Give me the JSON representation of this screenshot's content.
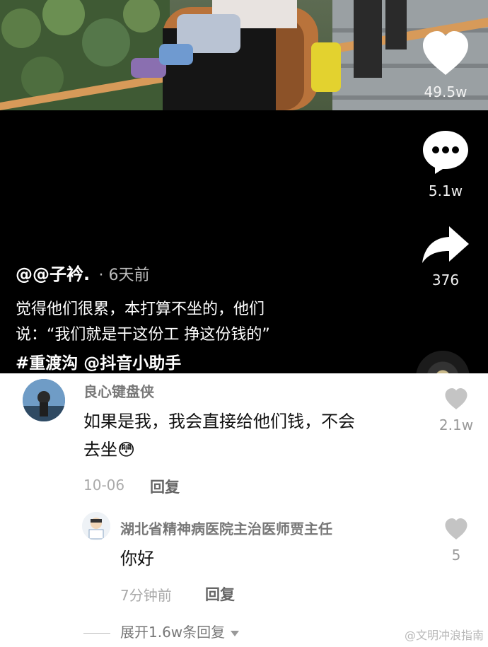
{
  "video": {
    "likes": "49.5w",
    "comments_count": "5.1w",
    "shares": "376",
    "author": "@@子衿.",
    "posted": "· 6天前",
    "caption_line1": "觉得他们很累，本打算不坐的，他们",
    "caption_line2": "说：“我们就是干这份工 挣这份钱的”",
    "tag_topic": "#重渡沟",
    "tag_mention": "@抖音小助手"
  },
  "comments": [
    {
      "nickname": "良心键盘侠",
      "text_line1": "如果是我，我会直接给他们钱，不会",
      "text_line2": "去坐",
      "emoji": "😳",
      "date": "10-06",
      "reply_label": "回复",
      "likes": "2.1w"
    },
    {
      "nickname": "湖北省精神病医院主治医师贾主任",
      "text": "你好",
      "date": "7分钟前",
      "reply_label": "回复",
      "likes": "5"
    }
  ],
  "expand_label": "展开1.6w条回复",
  "watermark": "@文明冲浪指南",
  "icons": {
    "like": "heart-icon",
    "comment": "comment-bubble-icon",
    "share": "share-arrow-icon",
    "expand": "caret-down-icon"
  },
  "colors": {
    "video_bg": "#000000",
    "comment_bg": "#ffffff",
    "like_gray": "#c4c4c4"
  }
}
